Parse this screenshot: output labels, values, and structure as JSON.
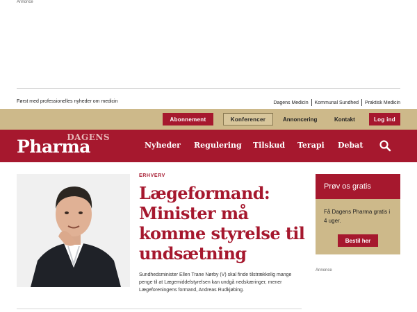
{
  "ads": {
    "top_label": "Annonce",
    "right_label": "Annonce"
  },
  "topbar": {
    "tagline": "Først med professionelles nyheder om medicin",
    "sister_sites": [
      "Dagens Medicin",
      "Kommunal Sundhed",
      "Praktisk Medicin"
    ]
  },
  "utility": {
    "subscription": "Abonnement",
    "conferences": "Konferencer",
    "advertising": "Annoncering",
    "contact": "Kontakt",
    "login": "Log ind"
  },
  "brand": {
    "small": "DAGENS",
    "big": "Pharma"
  },
  "nav": {
    "items": [
      "Nyheder",
      "Regulering",
      "Tilskud",
      "Terapi",
      "Debat"
    ],
    "search_icon": "search-icon"
  },
  "article": {
    "category": "ERHVERV",
    "headline": "Lægeformand: Minister må komme styrelse til undsætning",
    "teaser": "Sundhedsminister Ellen Trane Nørby (V) skal finde tilstrækkelig mange penge til at Lægemiddelstyrelsen kan undgå nedskæringer, mener Lægeforeningens formand, Andreas Rudkjøbing."
  },
  "promo": {
    "title": "Prøv os gratis",
    "body": "Få Dagens Pharma gratis i 4 uger.",
    "cta": "Bestil her"
  },
  "colors": {
    "brand_red": "#a6182e",
    "gold": "#cdb98a"
  }
}
